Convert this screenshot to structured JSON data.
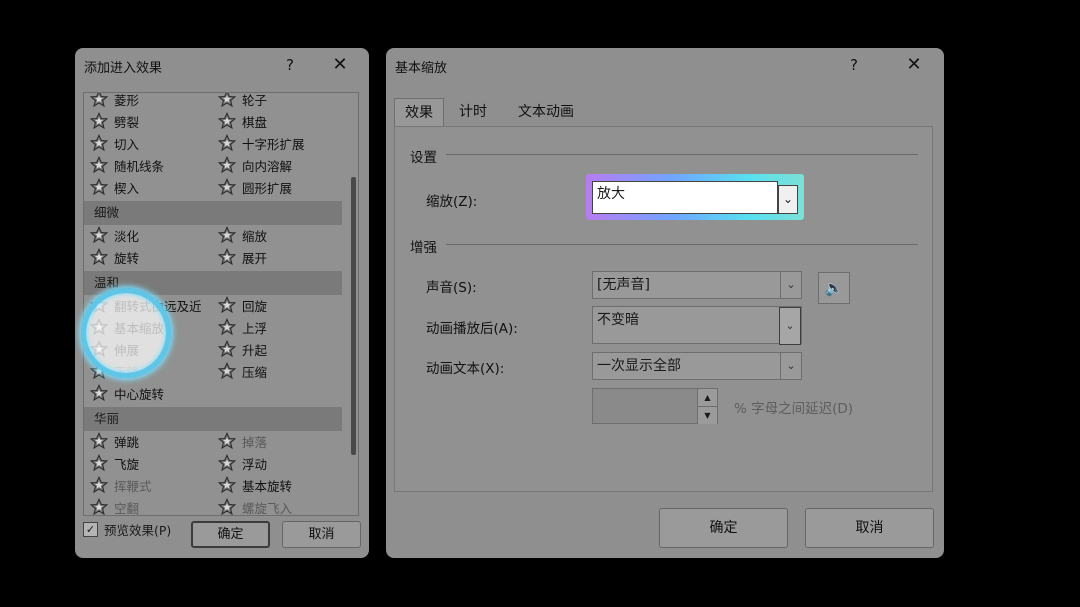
{
  "left_dialog": {
    "title": "添加进入效果",
    "help": "?",
    "close": "✕",
    "items_top": [
      {
        "col1": "菱形",
        "col2": "轮子"
      },
      {
        "col1": "劈裂",
        "col2": "棋盘"
      },
      {
        "col1": "切入",
        "col2": "十字形扩展"
      },
      {
        "col1": "随机线条",
        "col2": "向内溶解"
      },
      {
        "col1": "楔入",
        "col2": "圆形扩展"
      }
    ],
    "cat_subtle": "细微",
    "items_subtle": [
      {
        "col1": "淡化",
        "col2": "缩放"
      },
      {
        "col1": "旋转",
        "col2": "展开"
      }
    ],
    "cat_moderate": "温和",
    "items_moderate": [
      {
        "col1": "翻转式由远及近",
        "col2": "回旋"
      },
      {
        "col1": "基本缩放",
        "col2": "上浮"
      },
      {
        "col1": "伸展",
        "col2": "升起"
      },
      {
        "col1": "下降",
        "col2": "压缩"
      },
      {
        "col1": "中心旋转",
        "col2": ""
      }
    ],
    "cat_exciting": "华丽",
    "items_exciting": [
      {
        "col1": "弹跳",
        "col2": "掉落"
      },
      {
        "col1": "飞旋",
        "col2": "浮动"
      },
      {
        "col1": "挥鞭式",
        "col2": "基本旋转"
      },
      {
        "col1": "空翻",
        "col2": "螺旋飞入"
      }
    ],
    "preview_checked": "✓",
    "preview_label": "预览效果(P)",
    "ok": "确定",
    "cancel": "取消"
  },
  "right_dialog": {
    "title": "基本缩放",
    "help": "?",
    "close": "✕",
    "tabs": [
      "效果",
      "计时",
      "文本动画"
    ],
    "section_settings": "设置",
    "zoom_label": "缩放(Z):",
    "zoom_value": "放大",
    "section_enhance": "增强",
    "sound_label": "声音(S):",
    "sound_value": "[无声音]",
    "after_label": "动画播放后(A):",
    "after_value": "不变暗",
    "text_label": "动画文本(X):",
    "text_value": "一次显示全部",
    "delay_label": "% 字母之间延迟(D)",
    "ok": "确定",
    "cancel": "取消"
  },
  "colors": {
    "background": "#000000",
    "dialog": "#8f8f8f",
    "highlight_ring": "#5fc6e8",
    "glow_start": "#b77cf0",
    "glow_end": "#58e0f0"
  }
}
